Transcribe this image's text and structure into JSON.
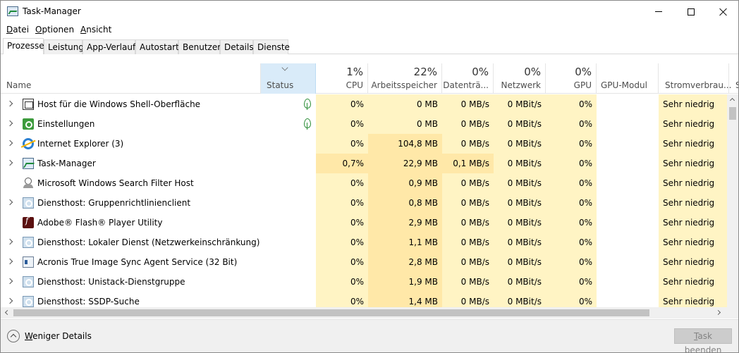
{
  "window": {
    "title": "Task-Manager"
  },
  "menu": [
    {
      "acc": "D",
      "rest": "atei"
    },
    {
      "acc": "O",
      "rest": "ptionen"
    },
    {
      "acc": "A",
      "rest": "nsicht"
    }
  ],
  "tabs": [
    "Prozesse",
    "Leistung",
    "App-Verlauf",
    "Autostart",
    "Benutzer",
    "Details",
    "Dienste"
  ],
  "header": {
    "name": "Name",
    "status": "Status",
    "cpu": {
      "pct": "1%",
      "label": "CPU"
    },
    "mem": {
      "pct": "22%",
      "label": "Arbeitsspeicher"
    },
    "disk": {
      "pct": "0%",
      "label": "Datenträ..."
    },
    "net": {
      "pct": "0%",
      "label": "Netzwerk"
    },
    "gpu": {
      "pct": "0%",
      "label": "GPU"
    },
    "gpu_engine": {
      "label": "GPU-Modul"
    },
    "power": {
      "label": "Stromverbrau..."
    },
    "power_trend": {
      "label": "S"
    }
  },
  "rows": [
    {
      "name": "Host für die Windows Shell-Oberfläche",
      "icon": "shell-host-icon",
      "expand": true,
      "leaf": true,
      "cpu": "0%",
      "mem": "0 MB",
      "disk": "0 MB/s",
      "net": "0 MBit/s",
      "gpu": "0%",
      "power": "Sehr niedrig"
    },
    {
      "name": "Einstellungen",
      "icon": "settings-icon",
      "expand": true,
      "leaf": true,
      "cpu": "0%",
      "mem": "0 MB",
      "disk": "0 MB/s",
      "net": "0 MBit/s",
      "gpu": "0%",
      "power": "Sehr niedrig"
    },
    {
      "name": "Internet Explorer (3)",
      "icon": "internet-explorer-icon",
      "expand": true,
      "leaf": false,
      "cpu": "0%",
      "mem": "104,8 MB",
      "disk": "0 MB/s",
      "net": "0 MBit/s",
      "gpu": "0%",
      "power": "Sehr niedrig"
    },
    {
      "name": "Task-Manager",
      "icon": "task-manager-icon",
      "expand": true,
      "leaf": false,
      "cpu": "0,7%",
      "mem": "22,9 MB",
      "disk": "0,1 MB/s",
      "net": "0 MBit/s",
      "gpu": "0%",
      "power": "Sehr niedrig"
    },
    {
      "name": "Microsoft Windows Search Filter Host",
      "icon": "search-filter-icon",
      "expand": false,
      "leaf": false,
      "cpu": "0%",
      "mem": "0,9 MB",
      "disk": "0 MB/s",
      "net": "0 MBit/s",
      "gpu": "0%",
      "power": "Sehr niedrig"
    },
    {
      "name": "Diensthost: Gruppenrichtlinienclient",
      "icon": "service-host-icon",
      "expand": true,
      "leaf": false,
      "cpu": "0%",
      "mem": "0,8 MB",
      "disk": "0 MB/s",
      "net": "0 MBit/s",
      "gpu": "0%",
      "power": "Sehr niedrig"
    },
    {
      "name": "Adobe® Flash® Player Utility",
      "icon": "flash-player-icon",
      "expand": false,
      "leaf": false,
      "cpu": "0%",
      "mem": "2,9 MB",
      "disk": "0 MB/s",
      "net": "0 MBit/s",
      "gpu": "0%",
      "power": "Sehr niedrig"
    },
    {
      "name": "Diensthost: Lokaler Dienst (Netzwerkeinschränkung)",
      "icon": "service-host-icon",
      "expand": true,
      "leaf": false,
      "cpu": "0%",
      "mem": "1,1 MB",
      "disk": "0 MB/s",
      "net": "0 MBit/s",
      "gpu": "0%",
      "power": "Sehr niedrig"
    },
    {
      "name": "Acronis True Image Sync Agent Service (32 Bit)",
      "icon": "acronis-icon",
      "expand": true,
      "leaf": false,
      "cpu": "0%",
      "mem": "2,8 MB",
      "disk": "0 MB/s",
      "net": "0 MBit/s",
      "gpu": "0%",
      "power": "Sehr niedrig"
    },
    {
      "name": "Diensthost: Unistack-Dienstgruppe",
      "icon": "service-host-icon",
      "expand": true,
      "leaf": false,
      "cpu": "0%",
      "mem": "1,9 MB",
      "disk": "0 MB/s",
      "net": "0 MBit/s",
      "gpu": "0%",
      "power": "Sehr niedrig"
    },
    {
      "name": "Diensthost: SSDP-Suche",
      "icon": "service-host-icon",
      "expand": true,
      "leaf": false,
      "cpu": "0%",
      "mem": "1,4 MB",
      "disk": "0 MB/s",
      "net": "0 MBit/s",
      "gpu": "0%",
      "power": "Sehr niedrig"
    }
  ],
  "footer": {
    "less": {
      "acc": "W",
      "rest": "eniger Details"
    },
    "end_task": {
      "acc": "T",
      "rest": "ask beenden"
    }
  },
  "colors": {
    "heat_light": "#fff4c4",
    "heat_mid": "#ffe8a8",
    "heat_dark": "#ffd87a",
    "status_header": "#d9ebf9"
  }
}
